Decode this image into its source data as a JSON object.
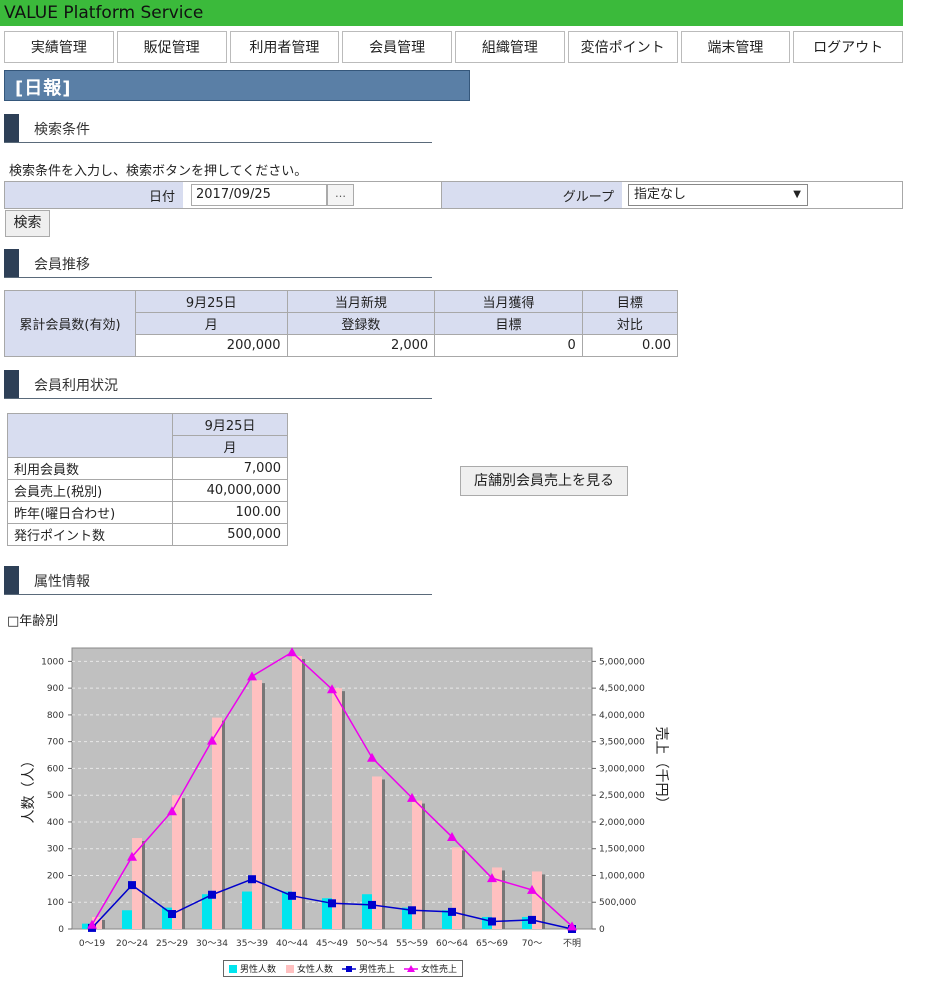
{
  "app_title": "VALUE Platform Service",
  "nav": [
    "実績管理",
    "販促管理",
    "利用者管理",
    "会員管理",
    "組織管理",
    "変倍ポイント",
    "端末管理",
    "ログアウト"
  ],
  "page_title": "[日報]",
  "sections": {
    "search": "検索条件",
    "member_trend": "会員推移",
    "member_usage": "会員利用状況",
    "attributes": "属性情報"
  },
  "search": {
    "instruction": "検索条件を入力し、検索ボタンを押してください。",
    "date_label": "日付",
    "date_value": "2017/09/25",
    "date_button": "…",
    "group_label": "グループ",
    "group_value": "指定なし",
    "search_button": "検索"
  },
  "trend_table": {
    "row_header": "累計会員数(有効)",
    "cols": [
      {
        "h1": "9月25日",
        "h2": "月",
        "value": "200,000"
      },
      {
        "h1": "当月新規",
        "h2": "登録数",
        "value": "2,000"
      },
      {
        "h1": "当月獲得",
        "h2": "目標",
        "value": "0"
      },
      {
        "h1": "目標",
        "h2": "対比",
        "value": "0.00"
      }
    ]
  },
  "usage_table": {
    "h1": "9月25日",
    "h2": "月",
    "rows": [
      {
        "label": "利用会員数",
        "value": "7,000"
      },
      {
        "label": "会員売上(税別)",
        "value": "40,000,000"
      },
      {
        "label": "昨年(曜日合わせ)",
        "value": "100.00"
      },
      {
        "label": "発行ポイント数",
        "value": "500,000"
      }
    ]
  },
  "store_sales_button": "店舗別会員売上を見る",
  "age_caption": "□年齢別",
  "chart_data": {
    "type": "bar",
    "categories": [
      "0～19",
      "20～24",
      "25～29",
      "30～34",
      "35～39",
      "40～44",
      "45～49",
      "50～54",
      "55～59",
      "60～64",
      "65～69",
      "70～",
      "不明"
    ],
    "ylabel": "人数（人）",
    "y2label": "売上（千円）",
    "ylim": [
      0,
      1050
    ],
    "yticks": [
      0,
      100,
      200,
      300,
      400,
      500,
      600,
      700,
      800,
      900,
      1000
    ],
    "y2lim": [
      0,
      5250000
    ],
    "y2ticks": [
      0,
      500000,
      1000000,
      1500000,
      2000000,
      2500000,
      3000000,
      3500000,
      4000000,
      4500000,
      5000000
    ],
    "y2tick_labels": [
      "0",
      "500,000",
      "1,000,000",
      "1,500,000",
      "2,000,000",
      "2,500,000",
      "3,000,000",
      "3,500,000",
      "4,000,000",
      "4,500,000",
      "5,000,000"
    ],
    "grid": true,
    "legend_position": "bottom",
    "series": [
      {
        "name": "男性人数",
        "kind": "bar",
        "axis": "left",
        "color": "#00e5ee",
        "values": [
          20,
          70,
          80,
          130,
          140,
          140,
          115,
          130,
          80,
          70,
          45,
          45,
          0
        ]
      },
      {
        "name": "女性人数",
        "kind": "bar",
        "axis": "left",
        "color": "#ffc0c0",
        "values": [
          45,
          340,
          500,
          790,
          930,
          1020,
          900,
          570,
          480,
          305,
          230,
          215,
          0
        ]
      },
      {
        "name": "男性売上",
        "kind": "line",
        "axis": "right",
        "color": "#0000cc",
        "marker": "square",
        "values": [
          20000,
          820000,
          280000,
          640000,
          930000,
          620000,
          480000,
          450000,
          350000,
          320000,
          140000,
          170000,
          0
        ]
      },
      {
        "name": "女性売上",
        "kind": "line",
        "axis": "right",
        "color": "#ee00ee",
        "marker": "triangle",
        "values": [
          80000,
          1350000,
          2200000,
          3520000,
          4720000,
          5170000,
          4480000,
          3200000,
          2450000,
          1720000,
          950000,
          730000,
          50000
        ]
      }
    ]
  }
}
